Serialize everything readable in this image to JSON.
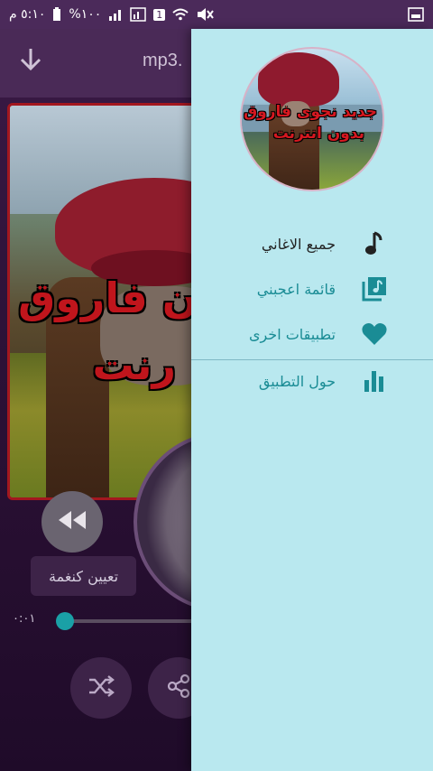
{
  "status_bar": {
    "time": "٥:١٠ م",
    "battery": "%١٠٠",
    "notification_badge": "1"
  },
  "player": {
    "file_title": "mp3.",
    "artwork_text_line1": "ن فاروق",
    "artwork_text_line2": "رنت",
    "set_ringtone_label": "تعيين كنغمة",
    "elapsed_time": "٠:٠١",
    "progress": 0.0
  },
  "drawer": {
    "header_avatar_text_line1": "جديد نجوى فاروق",
    "header_avatar_text_line2": "بدون انترنت",
    "items": [
      {
        "label": "جميع الاغاني",
        "icon": "music-note-icon",
        "color": "#222222"
      },
      {
        "label": "قائمة اعجبني",
        "icon": "playlist-icon",
        "color": "#1a8c95"
      },
      {
        "label": "تطبيقات اخرى",
        "icon": "heart-icon",
        "color": "#1a8c95"
      },
      {
        "label": "حول التطبيق",
        "icon": "bar-chart-icon",
        "color": "#1a8c95"
      }
    ]
  },
  "colors": {
    "accent_teal": "#1aa0a6",
    "drawer_bg": "#b9e8ef",
    "statusbar_bg": "#4b2a5a"
  }
}
